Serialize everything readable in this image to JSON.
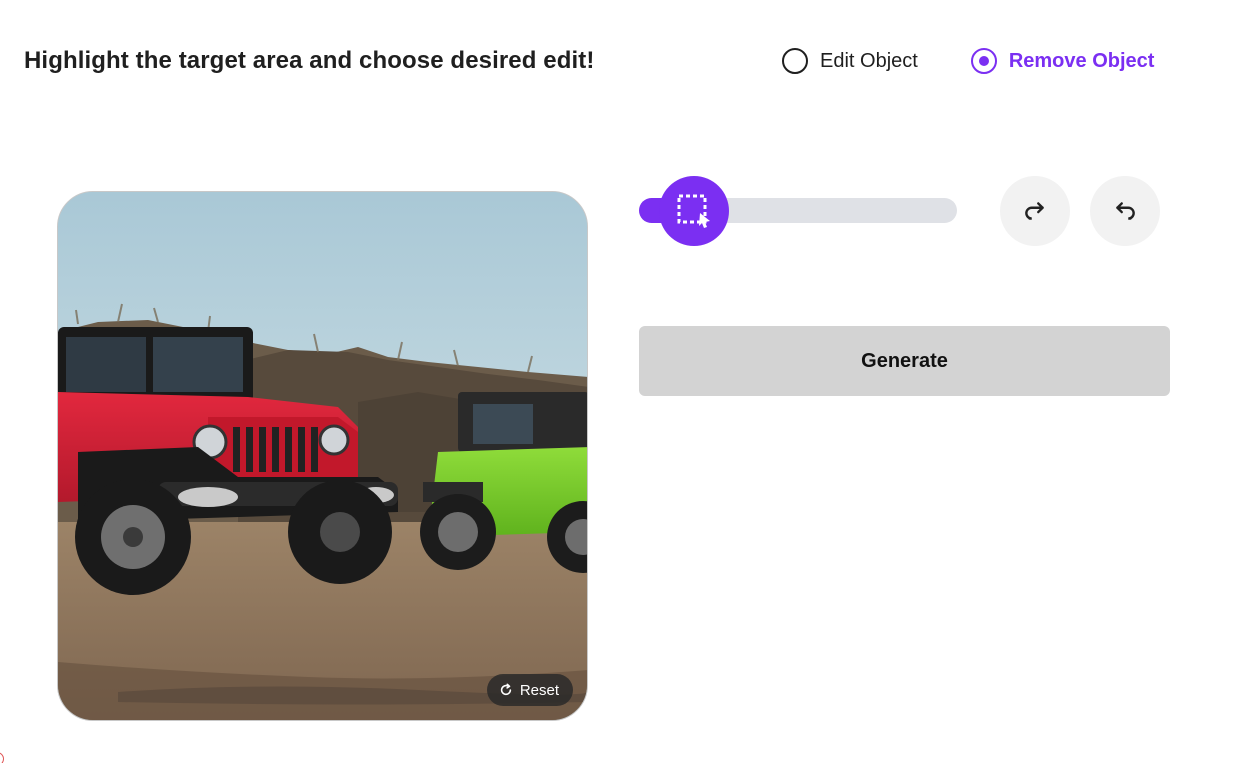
{
  "header": {
    "instruction": "Highlight the target area and choose desired edit!"
  },
  "mode": {
    "options": [
      {
        "label": "Edit Object",
        "selected": false
      },
      {
        "label": "Remove Object",
        "selected": true
      }
    ],
    "accent_color": "#7b2ff2"
  },
  "image": {
    "reset_label": "Reset",
    "reset_icon": "refresh-icon"
  },
  "brush_slider": {
    "level_fraction": 0.16,
    "thumb_icon": "select-area-cursor-icon"
  },
  "history": {
    "redo_icon": "redo-icon",
    "undo_icon": "undo-icon"
  },
  "actions": {
    "generate_label": "Generate"
  }
}
